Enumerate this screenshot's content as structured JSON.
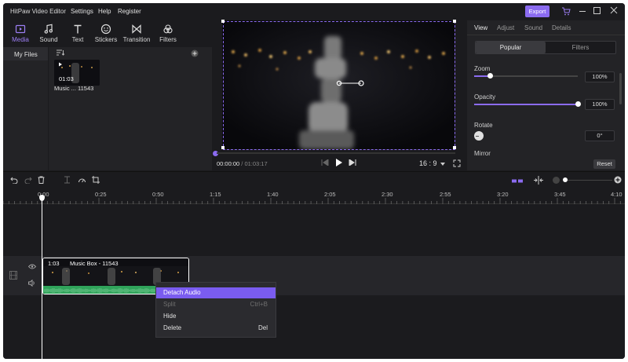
{
  "app": {
    "title": "HitPaw Video Editor"
  },
  "menu": {
    "settings": "Settings",
    "help": "Help",
    "register": "Register",
    "export": "Export"
  },
  "tabs": [
    {
      "label": "Media",
      "icon": "media-icon"
    },
    {
      "label": "Sound",
      "icon": "music-note-icon"
    },
    {
      "label": "Text",
      "icon": "text-icon"
    },
    {
      "label": "Stickers",
      "icon": "smiley-icon"
    },
    {
      "label": "Transition",
      "icon": "bowtie-icon"
    },
    {
      "label": "Filters",
      "icon": "filters-icon"
    }
  ],
  "media": {
    "my_files": "My Files",
    "thumb_duration": "01:03",
    "thumb_name": "Music ... 11543"
  },
  "player": {
    "current_time": "00:00:00",
    "total_time": " / 01:03:17",
    "ratio": "16 : 9"
  },
  "right_panel": {
    "tabs": [
      "View",
      "Adjust",
      "Sound",
      "Details"
    ],
    "segment_active": "Popular",
    "segment_other": "Filters",
    "zoom_label": "Zoom",
    "zoom_value": "100%",
    "zoom_level": 0.15,
    "opacity_label": "Opacity",
    "opacity_value": "100%",
    "opacity_level": 1.0,
    "rotate_label": "Rotate",
    "rotate_value": "0°",
    "mirror_label": "Mirror",
    "reset": "Reset"
  },
  "timeline": {
    "ticks": [
      "0:00",
      "0:25",
      "0:50",
      "1:15",
      "1:40",
      "2:05",
      "2:30",
      "2:55",
      "3:20",
      "3:45",
      "4:10"
    ],
    "clip_duration": "1:03",
    "clip_name": "Music Box - 11543"
  },
  "context_menu": {
    "items": [
      {
        "label": "Detach Audio",
        "shortcut": ""
      },
      {
        "label": "Split",
        "shortcut": "Ctrl+B"
      },
      {
        "label": "Hide",
        "shortcut": ""
      },
      {
        "label": "Delete",
        "shortcut": "Del"
      }
    ]
  },
  "colors": {
    "accent": "#8b6bf0",
    "highlight": "#7a5cf0",
    "audio": "#2fa35a",
    "bg": "#1b1b1e"
  }
}
